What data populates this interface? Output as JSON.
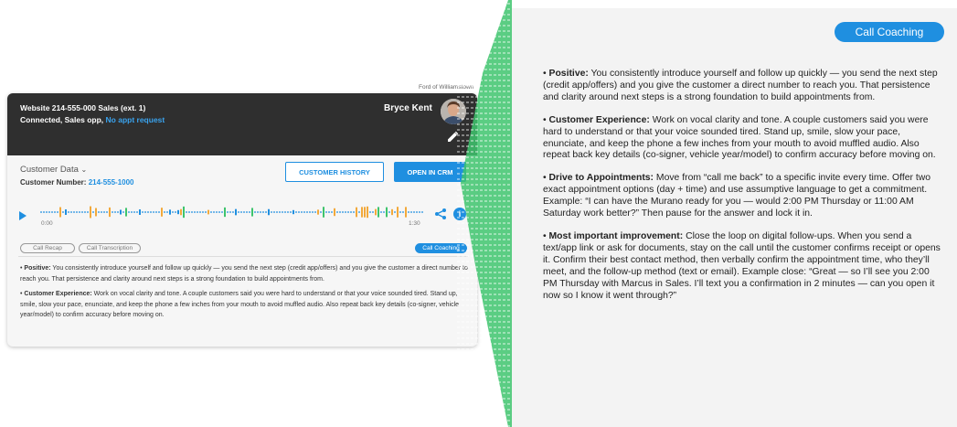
{
  "dealer": "Ford of Williamstown",
  "header": {
    "line1": "Website 214-555-000 Sales (ext. 1)",
    "status": "Connected, Sales opp,",
    "status_link": "No appt request",
    "agent": "Bryce Kent"
  },
  "customer": {
    "section_label": "Customer Data",
    "number_label": "Customer Number:",
    "number": "214-555-1000"
  },
  "buttons": {
    "history": "CUSTOMER HISTORY",
    "crm": "OPEN IN CRM"
  },
  "player": {
    "start": "0:00",
    "end": "1:30"
  },
  "tabs": {
    "recap": "Call Recap",
    "transcription": "Call Transcription",
    "coaching": "Call Coaching"
  },
  "bullet": "•",
  "card_preview": [
    {
      "title": "Positive:",
      "text": "You consistently introduce yourself and follow up quickly — you send the next step (credit app/offers) and you give the customer a direct number to reach you. That persistence and clarity around next steps is a strong foundation to build appointments from."
    },
    {
      "title": "Customer Experience:",
      "text": "Work on vocal clarity and tone. A couple customers said you were hard to understand or that your voice sounded tired. Stand up, smile, slow your pace, enunciate, and keep the phone a few inches from your mouth to avoid muffled audio. Also repeat back key details (co-signer, vehicle year/model) to confirm accuracy before moving on."
    }
  ],
  "panel": {
    "badge": "Call Coaching",
    "items": [
      {
        "title": "Positive:",
        "text": "You consistently introduce yourself and follow up quickly — you send the next step (credit app/offers) and you give the customer a direct number to reach you. That persistence and clarity around next steps is a strong foundation to build appointments from."
      },
      {
        "title": "Customer Experience:",
        "text": "Work on vocal clarity and tone. A couple customers said you were hard to understand or that your voice sounded tired. Stand up, smile, slow your pace, enunciate, and keep the phone a few inches from your mouth to avoid muffled audio. Also repeat back key details (co-signer, vehicle year/model) to confirm accuracy before moving on."
      },
      {
        "title": "Drive to Appointments:",
        "text": "Move from “call me back” to a specific invite every time. Offer two exact appointment options (day + time) and use assumptive language to get a commitment. Example: “I can have the Murano ready for you — would 2:00 PM Thursday or 11:00 AM Saturday work better?” Then pause for the answer and lock it in."
      },
      {
        "title": "Most important improvement:",
        "text": "Close the loop on digital follow-ups. When you send a text/app link or ask for documents, stay on the call until the customer confirms receipt or opens it. Confirm their best contact method, then verbally confirm the appointment time, who they’ll meet, and the follow-up method (text or email). Example close: “Great — so I’ll see you 2:00 PM Thursday with Marcus in Sales. I’ll text you a confirmation in 2 minutes — can you open it now so I know it went through?”"
      }
    ]
  },
  "colors": {
    "accent": "#1f8fe0",
    "header_bg": "#2f2f2f",
    "wave_blue": "#1f8fe0",
    "wave_green": "#3ec46d",
    "wave_orange": "#f2a93b"
  },
  "icons": [
    "play-icon",
    "share-icon",
    "info-icon",
    "pencil-icon",
    "chevron-down-icon",
    "avatar"
  ]
}
